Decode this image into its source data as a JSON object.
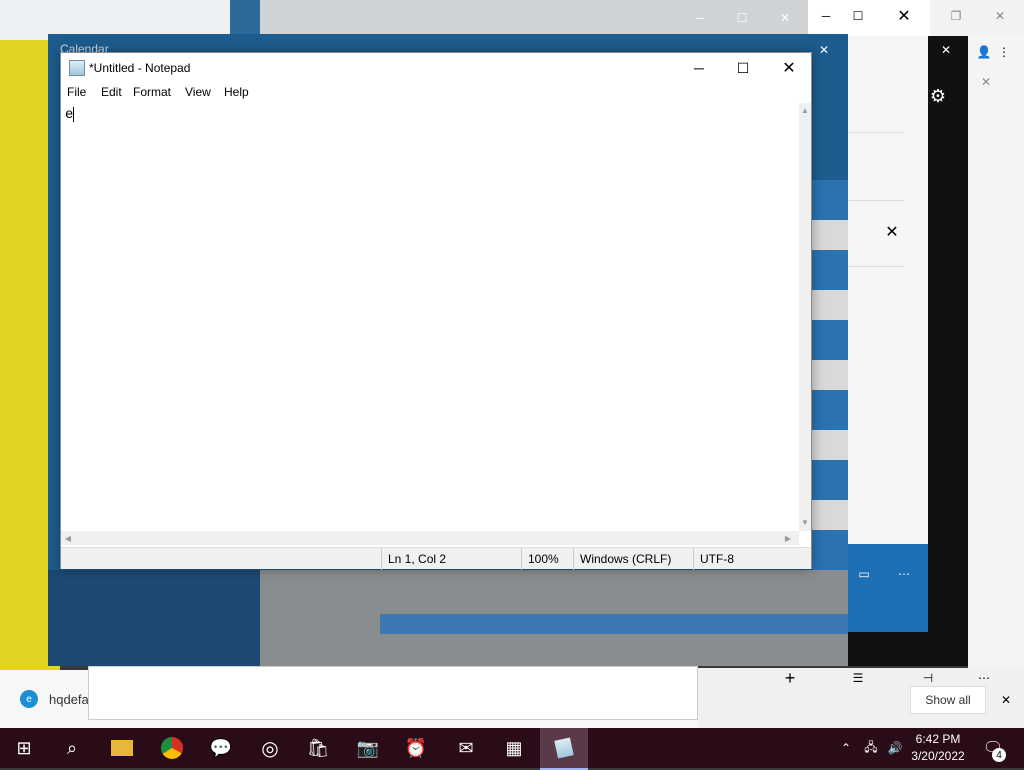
{
  "background": {
    "calendar_title": "Calendar",
    "edge_bar_text": "hqdefa",
    "notification_show_all": "Show all",
    "notification_badge": "4"
  },
  "notepad": {
    "title": "*Untitled - Notepad",
    "menu": [
      "File",
      "Edit",
      "Format",
      "View",
      "Help"
    ],
    "content": "e",
    "status": {
      "position": "Ln 1, Col 2",
      "zoom": "100%",
      "line_ending": "Windows (CRLF)",
      "encoding": "UTF-8"
    }
  },
  "taskbar": {
    "apps": [
      "start-icon",
      "search-icon",
      "file-explorer-icon",
      "chrome-icon",
      "feedback-icon",
      "groove-icon",
      "store-icon",
      "camera-icon",
      "alarms-icon",
      "mail-icon",
      "calendar-icon",
      "notepad-icon"
    ],
    "clock_time": "6:42 PM",
    "clock_date": "3/20/2022",
    "accent": "#2a0c18"
  }
}
